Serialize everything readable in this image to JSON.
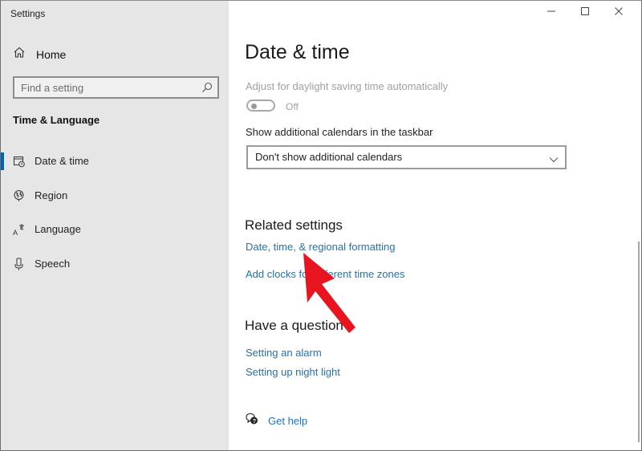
{
  "window": {
    "title": "Settings",
    "controls": {
      "minimize": "minimize",
      "maximize": "maximize",
      "close": "close"
    }
  },
  "sidebar": {
    "home_label": "Home",
    "search": {
      "placeholder": "Find a setting",
      "value": ""
    },
    "section_title": "Time & Language",
    "items": [
      {
        "label": "Date & time",
        "icon": "calendar-clock-icon",
        "selected": true
      },
      {
        "label": "Region",
        "icon": "globe-icon",
        "selected": false
      },
      {
        "label": "Language",
        "icon": "language-icon",
        "selected": false
      },
      {
        "label": "Speech",
        "icon": "microphone-icon",
        "selected": false
      }
    ]
  },
  "main": {
    "page_title": "Date & time",
    "dst": {
      "label": "Adjust for daylight saving time automatically",
      "state": "Off"
    },
    "calendars": {
      "label": "Show additional calendars in the taskbar",
      "selected": "Don't show additional calendars"
    },
    "related": {
      "heading": "Related settings",
      "links": [
        "Date, time, & regional formatting",
        "Add clocks for different time zones"
      ]
    },
    "question": {
      "heading": "Have a question?",
      "links": [
        "Setting an alarm",
        "Setting up night light"
      ]
    },
    "get_help": "Get help"
  },
  "annotation": {
    "type": "arrow",
    "color": "#e8141f",
    "points_to": "Date, time, & regional formatting"
  },
  "colors": {
    "accent": "#0063b1",
    "link": "#1e72b9",
    "sidebar_bg": "#e6e6e6"
  }
}
